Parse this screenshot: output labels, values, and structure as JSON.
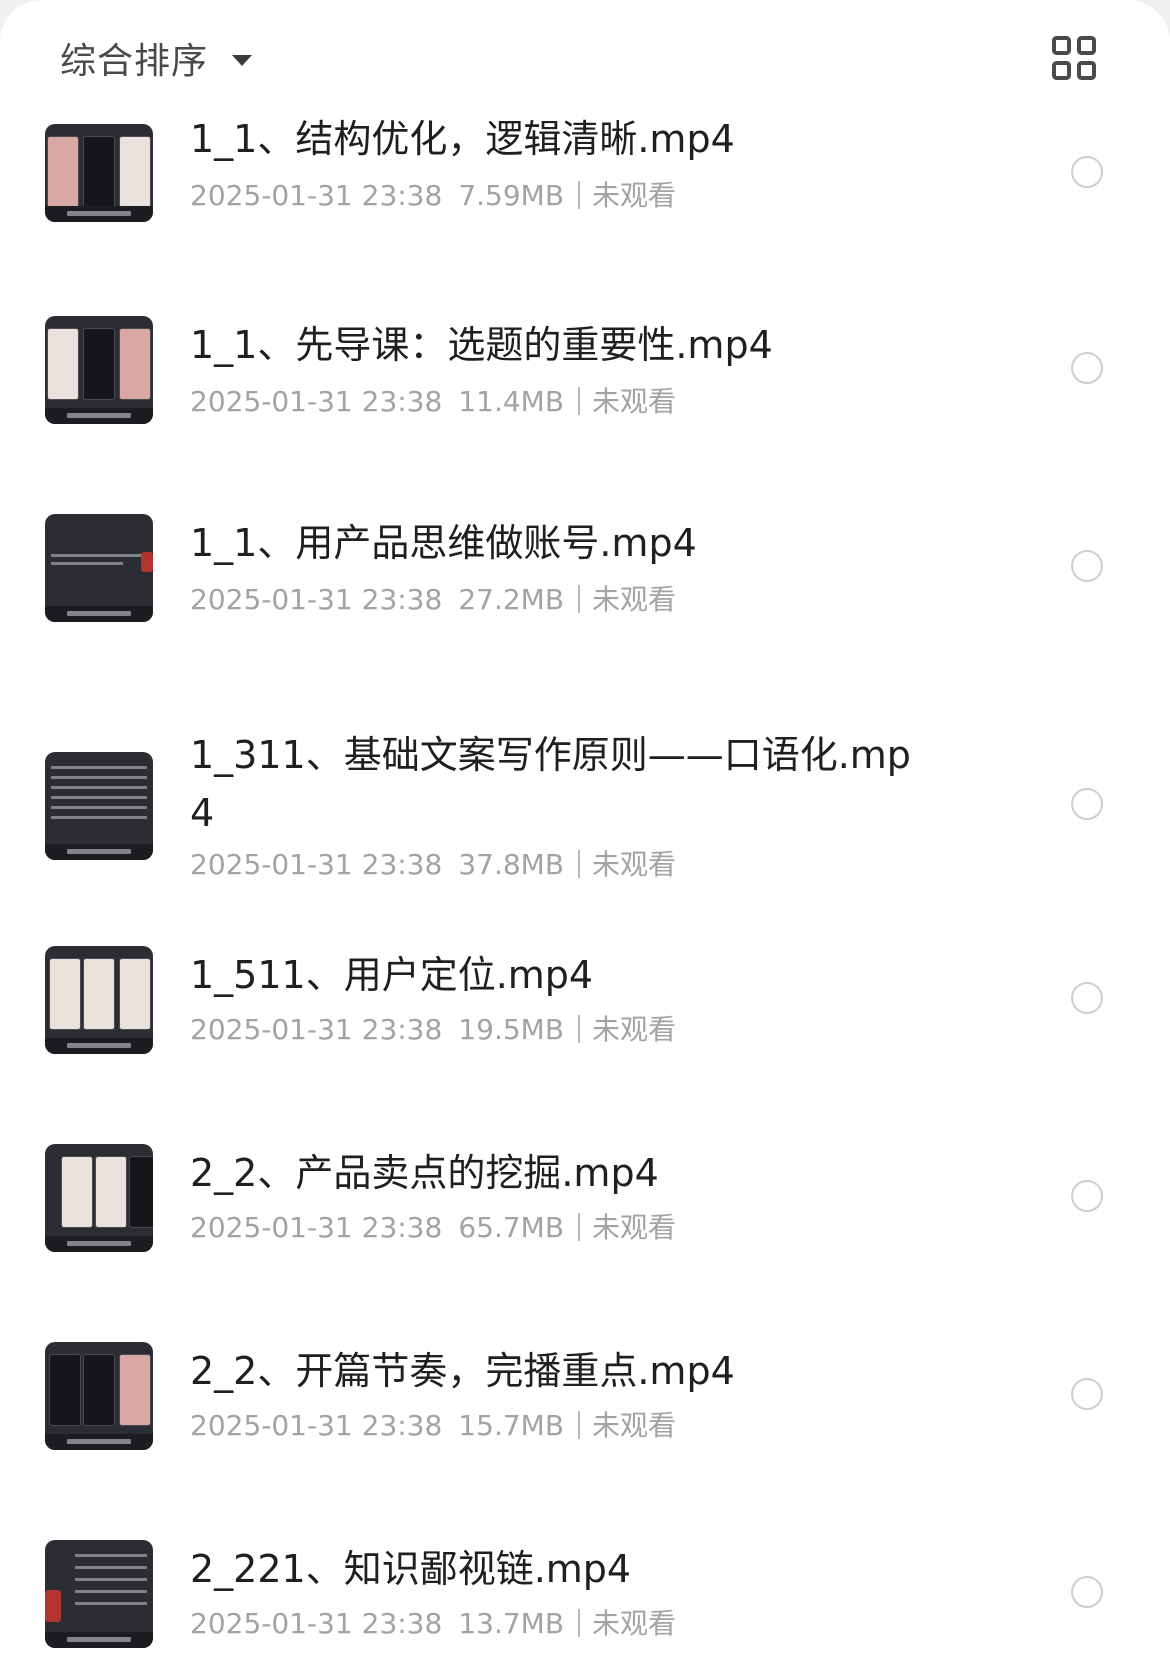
{
  "toolbar": {
    "sort_label": "综合排序",
    "sort_icon": "chevron-down-icon",
    "view_toggle_icon": "grid-view-icon"
  },
  "files": [
    {
      "title": "1_1、结构优化，逻辑清晰.mp4",
      "date": "2025-01-31 23:38",
      "size": "7.59MB",
      "status": "未观看"
    },
    {
      "title": "1_1、先导课：选题的重要性.mp4",
      "date": "2025-01-31 23:38",
      "size": "11.4MB",
      "status": "未观看"
    },
    {
      "title": "1_1、用产品思维做账号.mp4",
      "date": "2025-01-31 23:38",
      "size": "27.2MB",
      "status": "未观看"
    },
    {
      "title": "1_311、基础文案写作原则——口语化.mp4",
      "date": "2025-01-31 23:38",
      "size": "37.8MB",
      "status": "未观看"
    },
    {
      "title": "1_511、用户定位.mp4",
      "date": "2025-01-31 23:38",
      "size": "19.5MB",
      "status": "未观看"
    },
    {
      "title": "2_2、产品卖点的挖掘.mp4",
      "date": "2025-01-31 23:38",
      "size": "65.7MB",
      "status": "未观看"
    },
    {
      "title": "2_2、开篇节奏，完播重点.mp4",
      "date": "2025-01-31 23:38",
      "size": "15.7MB",
      "status": "未观看"
    },
    {
      "title": "2_221、知识鄙视链.mp4",
      "date": "2025-01-31 23:38",
      "size": "13.7MB",
      "status": "未观看"
    }
  ],
  "colors": {
    "title_text": "#1f1f1f",
    "meta_text": "#a3a3a3",
    "radio_border": "#cfcfcf",
    "thumbnail_bg": "#2b2d33"
  }
}
